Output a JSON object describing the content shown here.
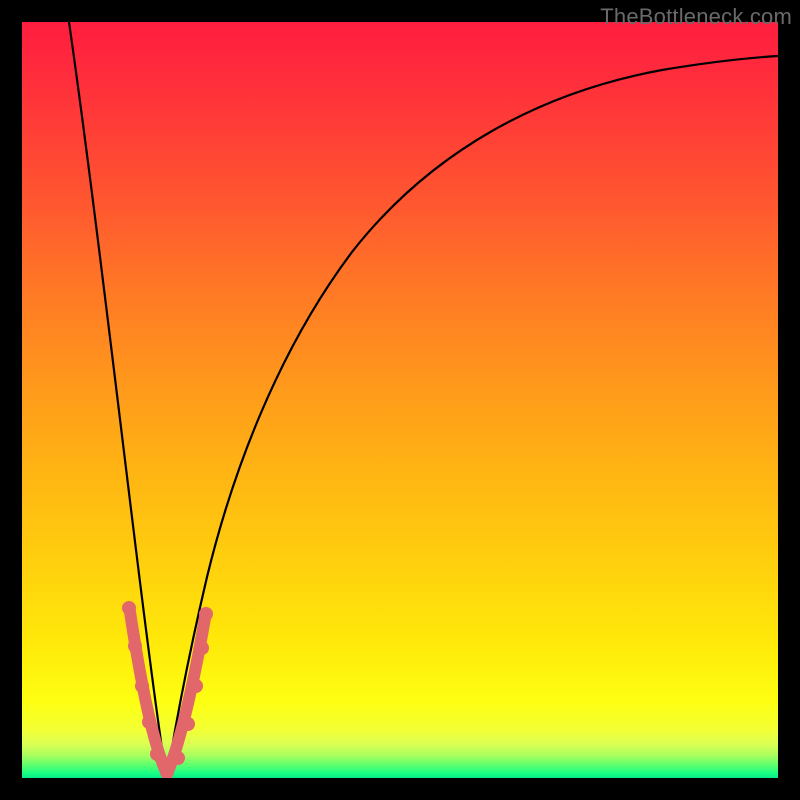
{
  "watermark": "TheBottleneck.com",
  "colors": {
    "black": "#000000",
    "dot": "#e1676b",
    "top": "#ff1d3f",
    "bottom": "#06e987"
  },
  "chart_data": {
    "type": "line",
    "title": "",
    "xlabel": "",
    "ylabel": "",
    "xlim": [
      0,
      100
    ],
    "ylim": [
      0,
      100
    ],
    "grid": false,
    "legend": false,
    "series": [
      {
        "name": "left-branch",
        "x": [
          6,
          8,
          10,
          12,
          14,
          16,
          17,
          18
        ],
        "y": [
          100,
          80,
          58,
          38,
          20,
          7,
          2,
          0
        ]
      },
      {
        "name": "right-branch",
        "x": [
          18,
          20,
          23,
          27,
          33,
          42,
          55,
          72,
          88,
          100
        ],
        "y": [
          0,
          8,
          22,
          38,
          54,
          68,
          80,
          89,
          94,
          97
        ]
      }
    ],
    "markers": {
      "name": "highlight-dots",
      "x": [
        13.5,
        14.3,
        15.2,
        16.1,
        17.0,
        18.0,
        19.3,
        20.8,
        22.0,
        23.0,
        23.7
      ],
      "y": [
        23,
        17,
        11,
        6,
        2.5,
        0.8,
        2.0,
        6,
        11,
        17,
        22
      ]
    },
    "valley_x": 18
  }
}
